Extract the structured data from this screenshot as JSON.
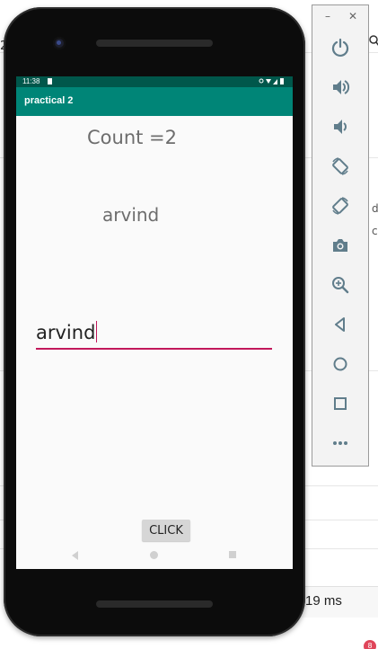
{
  "ide": {
    "left_fragment": "2",
    "right_fragments": [
      "d",
      "c"
    ],
    "status_text": "19 ms",
    "notification_count": "8"
  },
  "emulator": {
    "window_controls": {
      "minimize": "–",
      "close": "✕"
    },
    "toolbar_icons": [
      "power-icon",
      "volume-up-icon",
      "volume-down-icon",
      "rotate-left-icon",
      "rotate-right-icon",
      "camera-icon",
      "zoom-icon",
      "back-icon",
      "home-icon",
      "overview-icon",
      "more-icon"
    ]
  },
  "device": {
    "status_bar": {
      "time": "11:38"
    },
    "app_bar": {
      "title": "practical 2"
    },
    "content": {
      "count_text": "Count =2",
      "name_text": "arvind",
      "input_value": "arvind",
      "button_label": "CLICK"
    },
    "nav_icons": [
      "nav-back-icon",
      "nav-home-icon",
      "nav-recent-icon"
    ]
  },
  "colors": {
    "status_bar": "#00574b",
    "app_bar": "#008577",
    "accent": "#c2185b",
    "toolbar_icon": "#607d8b"
  }
}
